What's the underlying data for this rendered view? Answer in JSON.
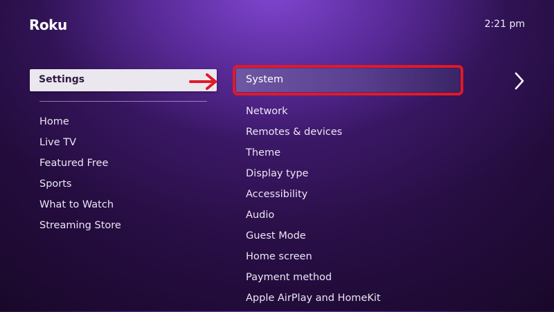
{
  "header": {
    "logo_text": "Roku",
    "clock": "2:21 pm"
  },
  "left_menu": {
    "selected": "Settings",
    "items": [
      "Home",
      "Live TV",
      "Featured Free",
      "Sports",
      "What to Watch",
      "Streaming Store"
    ]
  },
  "settings_menu": {
    "focused": "System",
    "items": [
      "Network",
      "Remotes & devices",
      "Theme",
      "Display type",
      "Accessibility",
      "Audio",
      "Guest Mode",
      "Home screen",
      "Payment method",
      "Apple AirPlay and HomeKit"
    ]
  },
  "icons": {
    "pointer": "right-arrow-icon",
    "next": "chevron-right-icon"
  },
  "colors": {
    "highlight_border": "#e01a27",
    "background_purple": "#3b1764",
    "selected_pill": "#ebe7ee"
  }
}
